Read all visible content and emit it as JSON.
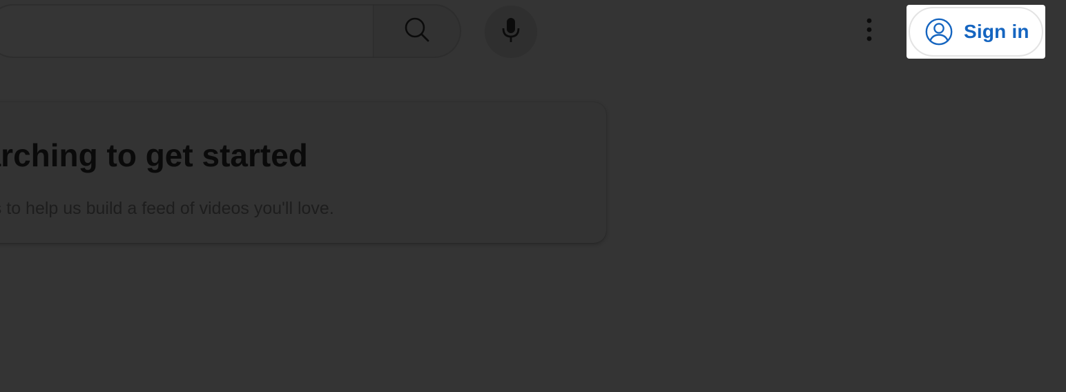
{
  "header": {
    "search": {
      "value": "",
      "placeholder": ""
    },
    "icons": {
      "search": "search-icon",
      "mic": "microphone-icon",
      "more": "more-vert-icon",
      "account": "account-circle-icon"
    },
    "sign_in_label": "Sign in",
    "sign_in_color": "#1565c0"
  },
  "main": {
    "prompt_title": "earching to get started",
    "prompt_subtitle": "eos to help us build a feed of videos you'll love."
  },
  "colors": {
    "overlay_background": "#343434",
    "highlight": "#ffffff"
  }
}
